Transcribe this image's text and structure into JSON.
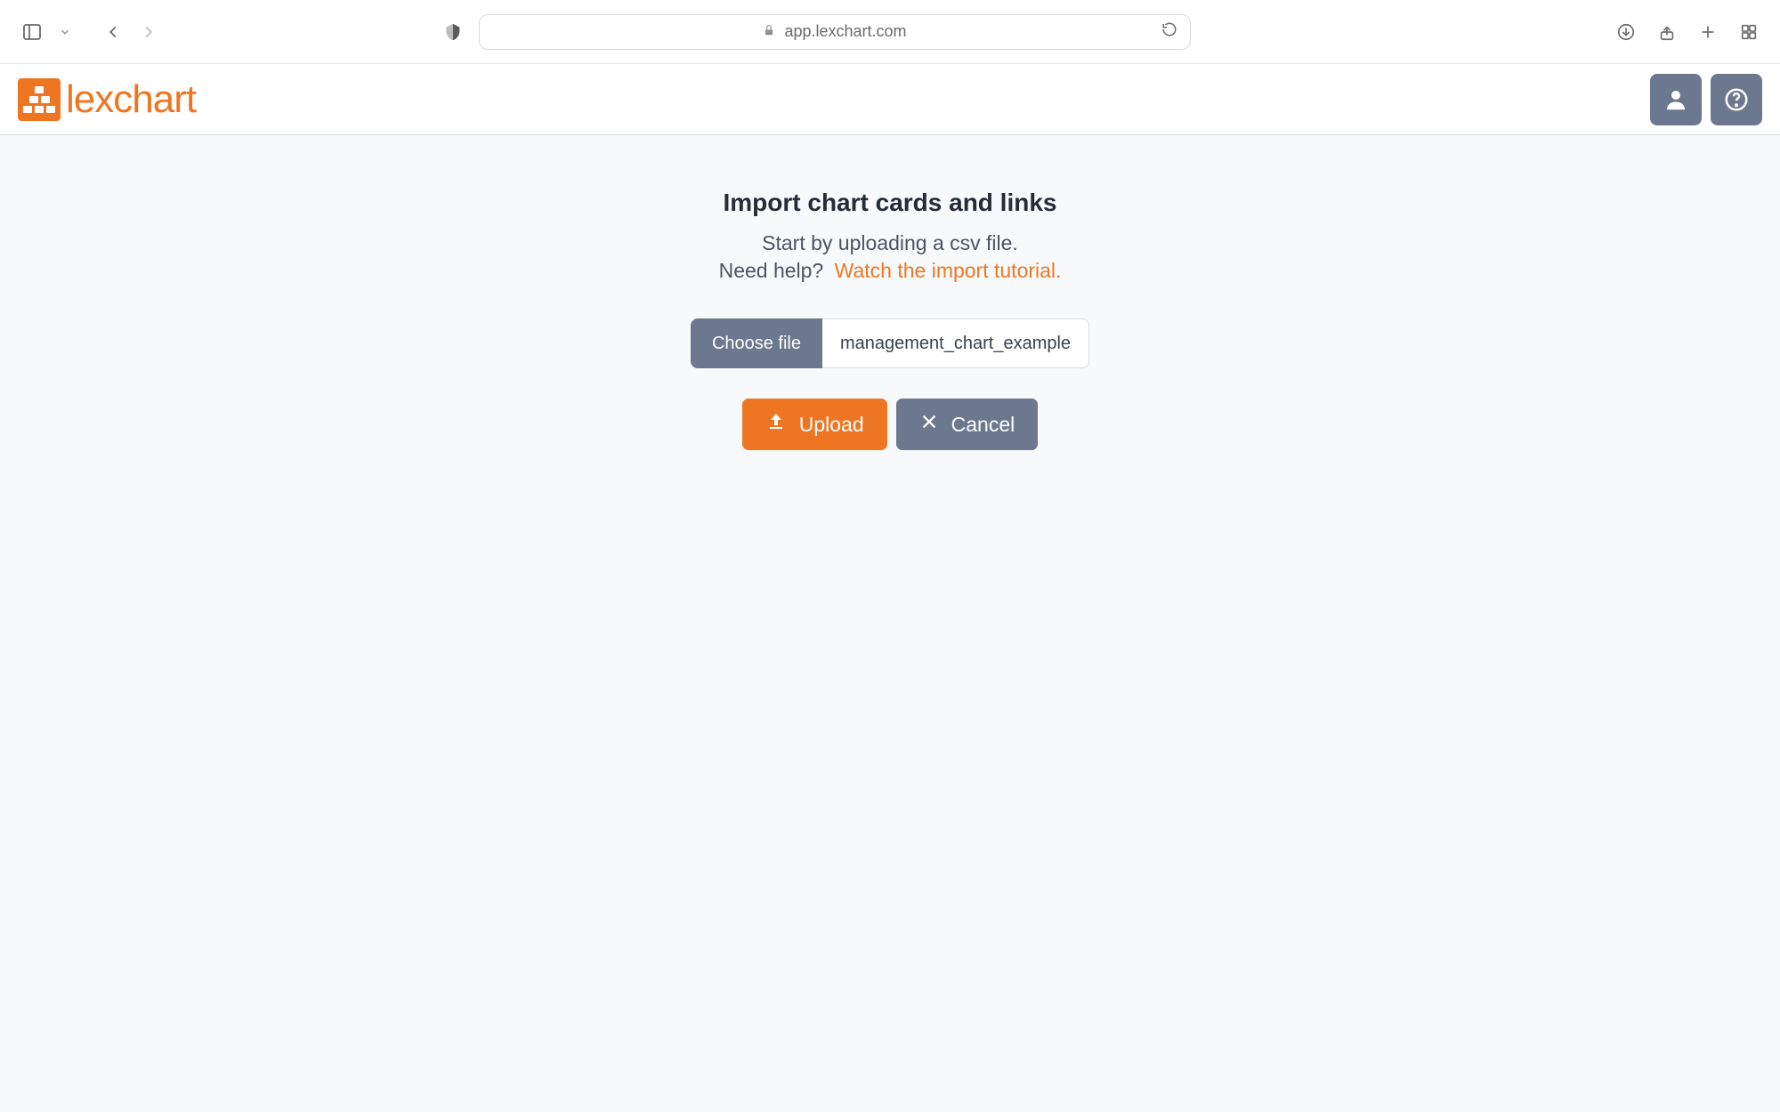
{
  "browser": {
    "url": "app.lexchart.com"
  },
  "app": {
    "logo_text": "lexchart"
  },
  "import": {
    "title": "Import chart cards and links",
    "subtitle": "Start by uploading a csv file.",
    "help_prefix": "Need help?",
    "help_link": "Watch the import tutorial.",
    "choose_file_label": "Choose file",
    "filename": "management_chart_example",
    "upload_label": "Upload",
    "cancel_label": "Cancel"
  }
}
